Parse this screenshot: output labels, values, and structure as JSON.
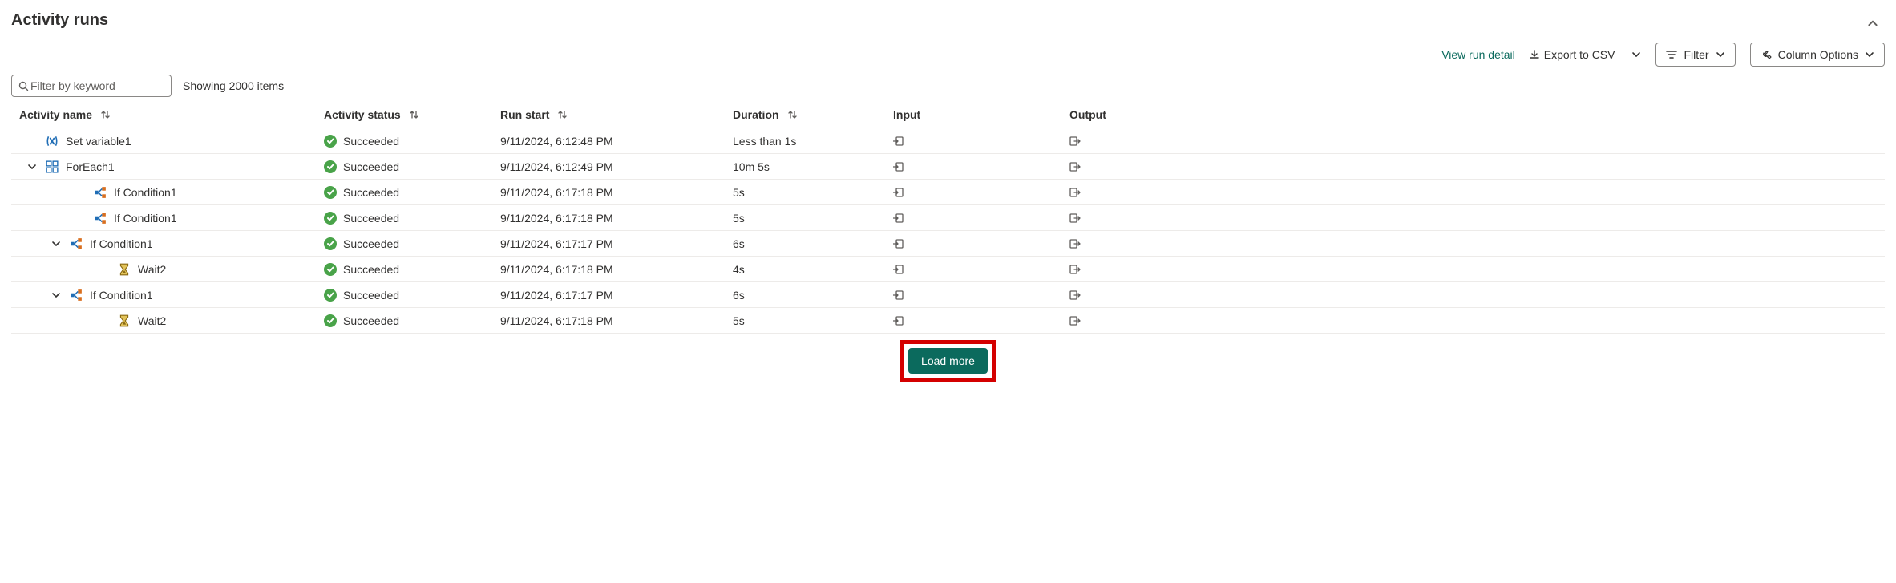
{
  "title": "Activity runs",
  "toolbar": {
    "view_detail": "View run detail",
    "export_label": "Export to CSV",
    "filter_label": "Filter",
    "column_options_label": "Column Options"
  },
  "filter": {
    "placeholder": "Filter by keyword",
    "item_count": "Showing 2000 items"
  },
  "columns": {
    "name": "Activity name",
    "status": "Activity status",
    "start": "Run start",
    "duration": "Duration",
    "input": "Input",
    "output": "Output"
  },
  "status_labels": {
    "succeeded": "Succeeded"
  },
  "rows": [
    {
      "indent": 0,
      "expandable": false,
      "expanded": false,
      "icon": "variable",
      "name": "Set variable1",
      "status": "succeeded",
      "start": "9/11/2024, 6:12:48 PM",
      "duration": "Less than 1s"
    },
    {
      "indent": 0,
      "expandable": true,
      "expanded": true,
      "icon": "foreach",
      "name": "ForEach1",
      "status": "succeeded",
      "start": "9/11/2024, 6:12:49 PM",
      "duration": "10m 5s"
    },
    {
      "indent": 2,
      "expandable": false,
      "expanded": false,
      "icon": "condition",
      "name": "If Condition1",
      "status": "succeeded",
      "start": "9/11/2024, 6:17:18 PM",
      "duration": "5s"
    },
    {
      "indent": 2,
      "expandable": false,
      "expanded": false,
      "icon": "condition",
      "name": "If Condition1",
      "status": "succeeded",
      "start": "9/11/2024, 6:17:18 PM",
      "duration": "5s"
    },
    {
      "indent": 1,
      "expandable": true,
      "expanded": true,
      "icon": "condition",
      "name": "If Condition1",
      "status": "succeeded",
      "start": "9/11/2024, 6:17:17 PM",
      "duration": "6s"
    },
    {
      "indent": 3,
      "expandable": false,
      "expanded": false,
      "icon": "wait",
      "name": "Wait2",
      "status": "succeeded",
      "start": "9/11/2024, 6:17:18 PM",
      "duration": "4s"
    },
    {
      "indent": 1,
      "expandable": true,
      "expanded": true,
      "icon": "condition",
      "name": "If Condition1",
      "status": "succeeded",
      "start": "9/11/2024, 6:17:17 PM",
      "duration": "6s"
    },
    {
      "indent": 3,
      "expandable": false,
      "expanded": false,
      "icon": "wait",
      "name": "Wait2",
      "status": "succeeded",
      "start": "9/11/2024, 6:17:18 PM",
      "duration": "5s"
    }
  ],
  "load_more": "Load more"
}
